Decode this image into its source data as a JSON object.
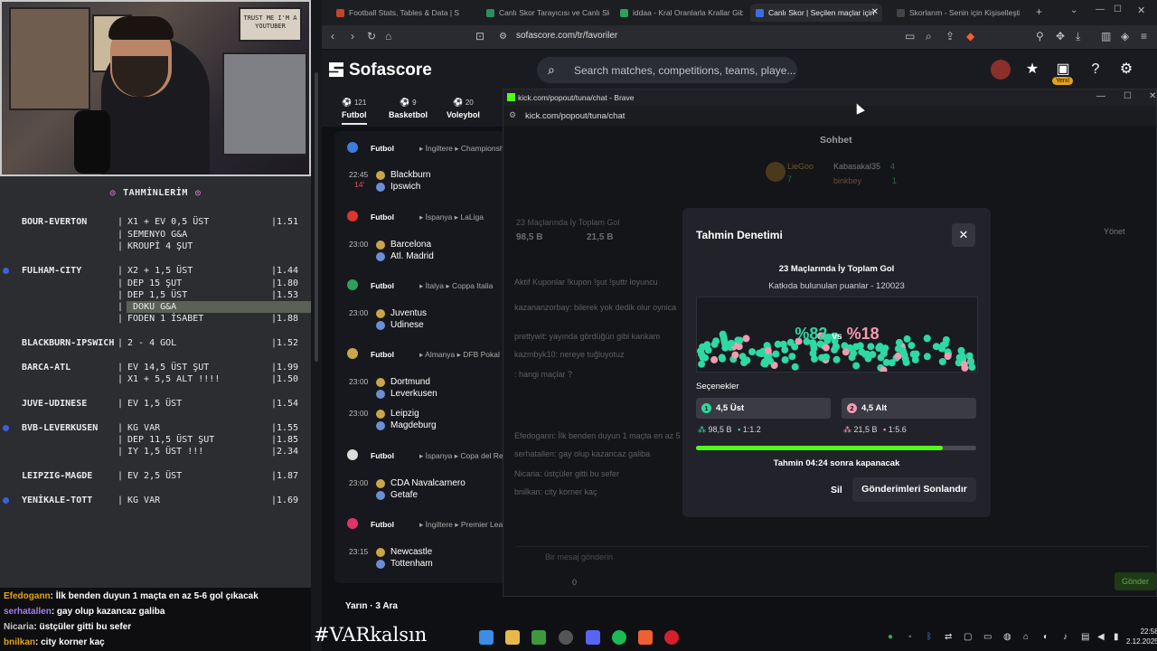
{
  "stream": {
    "predictions_title": "TAHMİNLERİM",
    "rows": [
      {
        "match": "BOUR-EVERTON",
        "bet": "X1 + EV 0,5 ÜST",
        "odd": "1.51",
        "dot": false,
        "hl": false
      },
      {
        "match": "",
        "bet": "SEMENYO G&A",
        "odd": "",
        "dot": false,
        "hl": false
      },
      {
        "match": "",
        "bet": "KROUPİ 4 ŞUT",
        "odd": "",
        "dot": false,
        "hl": false
      },
      {
        "match": "FULHAM-CITY",
        "bet": "X2 + 1,5 ÜST",
        "odd": "1.44",
        "dot": true,
        "hl": false
      },
      {
        "match": "",
        "bet": "DEP 15 ŞUT",
        "odd": "1.80",
        "dot": false,
        "hl": false
      },
      {
        "match": "",
        "bet": "DEP 1,5 ÜST",
        "odd": "1.53",
        "dot": false,
        "hl": false
      },
      {
        "match": "",
        "bet": "DOKU G&A",
        "odd": "2.07",
        "dot": false,
        "hl": true
      },
      {
        "match": "",
        "bet": "FODEN 1 İSABET",
        "odd": "1.88",
        "dot": false,
        "hl": false
      },
      {
        "match": "BLACKBURN-IPSWICH",
        "bet": "2 - 4 GOL",
        "odd": "1.52",
        "dot": false,
        "hl": false
      },
      {
        "match": "BARCA-ATL",
        "bet": "EV 14,5 ÜST ŞUT",
        "odd": "1.99",
        "dot": false,
        "hl": false
      },
      {
        "match": "",
        "bet": "X1 + 5,5 ALT !!!!",
        "odd": "1.50",
        "dot": false,
        "hl": false
      },
      {
        "match": "JUVE-UDINESE",
        "bet": "EV 1,5 ÜST",
        "odd": "1.54",
        "dot": false,
        "hl": false
      },
      {
        "match": "BVB-LEVERKUSEN",
        "bet": "KG VAR",
        "odd": "1.55",
        "dot": true,
        "hl": false
      },
      {
        "match": "",
        "bet": "DEP 11,5 ÜST ŞUT",
        "odd": "1.85",
        "dot": false,
        "hl": false
      },
      {
        "match": "",
        "bet": "IY 1,5 ÜST !!!",
        "odd": "2.34",
        "dot": false,
        "hl": false
      },
      {
        "match": "LEIPZIG-MAGDE",
        "bet": "EV 2,5 ÜST",
        "odd": "1.87",
        "dot": false,
        "hl": false
      },
      {
        "match": "YENİKALE-TOTT",
        "bet": "KG VAR",
        "odd": "1.69",
        "dot": true,
        "hl": false
      }
    ],
    "chat": [
      {
        "user": "Efedogann",
        "color": "#e3a21a",
        "msg": ": İlk benden duyun 1 maçta en az 5-6 gol çıkacak"
      },
      {
        "user": "serhatallen",
        "color": "#a77cf0",
        "msg": ": gay olup kazancaz galiba"
      },
      {
        "user": "Nicaria",
        "color": "#c9c9c9",
        "msg": ": üstçüler gitti bu sefer"
      },
      {
        "user": "bnilkan",
        "color": "#e3a21a",
        "msg": ": city korner kaç"
      }
    ],
    "hashtag": "#VARkalsın",
    "webcam_poster_text": "TRUST ME I'M A YOUTUBER"
  },
  "browser": {
    "tabs": [
      {
        "label": "Football Stats, Tables & Data | Soc",
        "color": "#c2452d",
        "active": false
      },
      {
        "label": "Canlı Skor Tarayıcısı ve Canlı Skorla",
        "color": "#2d8f5b",
        "active": false
      },
      {
        "label": "iddaa - Kral Oranlarla Krallar Gibi K",
        "color": "#2da05b",
        "active": false
      },
      {
        "label": "Canlı Skor | Seçilen maçlar için",
        "color": "#3d6de0",
        "active": true
      },
      {
        "label": "Skorlarım - Senin için Kişiselleştirilr",
        "color": "#444",
        "active": false
      }
    ],
    "url": "sofascore.com/tr/favoriler"
  },
  "sofascore": {
    "logo": "Sofascore",
    "search_placeholder": "Search matches, competitions, teams, playe...",
    "yeni_badge": "Yeni!",
    "sports": [
      {
        "label": "Futbol",
        "count": "121",
        "selected": true
      },
      {
        "label": "Basketbol",
        "count": "9",
        "selected": false
      },
      {
        "label": "Voleybol",
        "count": "20",
        "selected": false
      }
    ],
    "groups": [
      {
        "sport": "Futbol",
        "country": "İngiltere",
        "league": "Championship",
        "color": "#3c7dd9",
        "matches": [
          {
            "time": "22:45",
            "minute": "14'",
            "home": "Blackburn",
            "away": "Ipswich"
          }
        ]
      },
      {
        "sport": "Futbol",
        "country": "İspanya",
        "league": "LaLiga",
        "color": "#e0342c",
        "matches": [
          {
            "time": "23:00",
            "minute": "",
            "home": "Barcelona",
            "away": "Atl. Madrid"
          }
        ]
      },
      {
        "sport": "Futbol",
        "country": "İtalya",
        "league": "Coppa Italia",
        "color": "#2da05b",
        "matches": [
          {
            "time": "23:00",
            "minute": "",
            "home": "Juventus",
            "away": "Udinese"
          }
        ]
      },
      {
        "sport": "Futbol",
        "country": "Almanya",
        "league": "DFB Pokal",
        "color": "#c9a64a",
        "matches": [
          {
            "time": "23:00",
            "minute": "",
            "home": "Dortmund",
            "away": "Leverkusen"
          },
          {
            "time": "23:00",
            "minute": "",
            "home": "Leipzig",
            "away": "Magdeburg"
          }
        ]
      },
      {
        "sport": "Futbol",
        "country": "İspanya",
        "league": "Copa del Rey",
        "color": "#dcdcdc",
        "matches": [
          {
            "time": "23:00",
            "minute": "",
            "home": "CDA Navalcarnero",
            "away": "Getafe"
          }
        ]
      },
      {
        "sport": "Futbol",
        "country": "İngiltere",
        "league": "Premier League",
        "color": "#e0346a",
        "matches": [
          {
            "time": "23:15",
            "minute": "",
            "home": "Newcastle",
            "away": "Tottenham"
          }
        ]
      }
    ],
    "tomorrow": "Yarın · 3 Ara"
  },
  "kick": {
    "window_title": "kick.com/popout/tuna/chat - Brave",
    "url": "kick.com/popout/tuna/chat",
    "chat_title": "Sohbet",
    "top_users": [
      {
        "name": "LieGoo",
        "count": "7"
      },
      {
        "name": "Kabasakal35",
        "count": "4"
      },
      {
        "name": "binkbey",
        "count": "1"
      }
    ],
    "pinned_poll": {
      "title": "23 Maçlarında İy Toplam Gol",
      "left": "98,5 B",
      "right": "21,5 B"
    },
    "yonet": "Yönet",
    "bg_lines": [
      "Aktif Kuponlar !kupon !şut !şuttr loyuncu",
      "kazananzorbay: bilerek yok dedik olur oynica",
      "prettywit: yayında gördüğün gibi kankam",
      "kazmbyk10: nereye tuğluyotuz",
      ": hangi maçlar ?",
      "Efedogann: İlk benden duyun 1 maçta en az 5",
      "serhatallen: gay olup kazancaz galiba",
      "Nicaria: üstçüler gitti bu sefer",
      "bnilkan: city korner kaç"
    ],
    "input_placeholder": "Bir mesaj gönderin",
    "send": "Gönder",
    "bottom_count": "0"
  },
  "modal": {
    "title": "Tahmin Denetimi",
    "question": "23 Maçlarında İy Toplam Gol",
    "subtitle": "Katkıda bulunulan puanlar - 120023",
    "pct_left": "%82",
    "vs": "vs",
    "pct_right": "%18",
    "options_label": "Seçenekler",
    "options": [
      {
        "num": "1",
        "label": "4,5 Üst",
        "points": "98,5 B",
        "ratio": "1:1.2"
      },
      {
        "num": "2",
        "label": "4,5 Alt",
        "points": "21,5 B",
        "ratio": "1:5.6"
      }
    ],
    "progress": 0.88,
    "closes_in": "Tahmin 04:24 sonra kapanacak",
    "delete": "Sil",
    "end": "Gönderimleri Sonlandır"
  },
  "taskbar": {
    "time": "22:58",
    "date": "2.12.2025"
  }
}
